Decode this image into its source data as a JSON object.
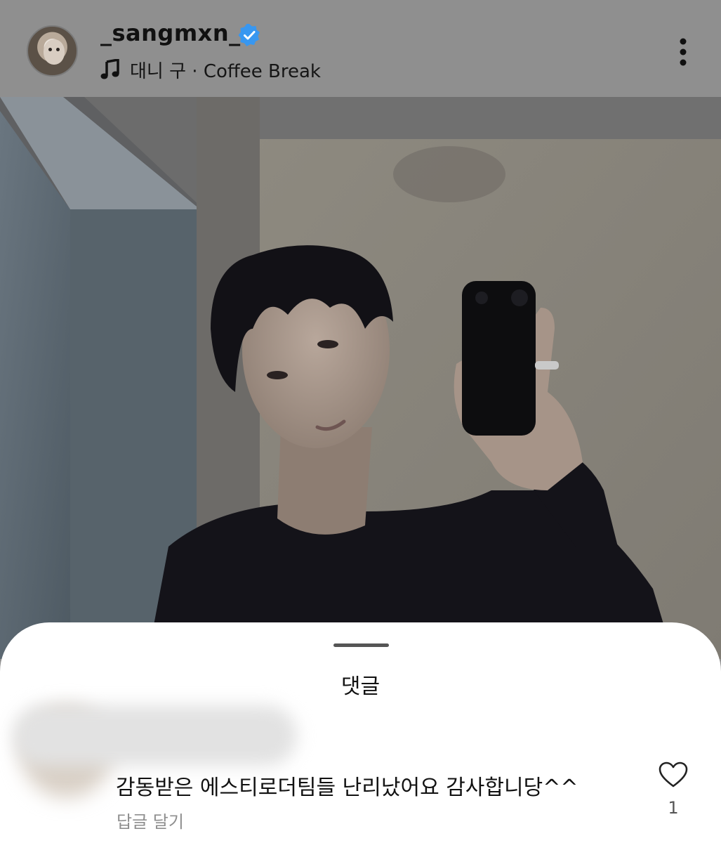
{
  "post": {
    "username": "_sangmxn_",
    "verified": true,
    "music": "대니 구 · Coffee Break",
    "avatar_icon": "dog-avatar",
    "more_icon": "more-vertical-icon"
  },
  "comments_sheet": {
    "title": "댓글",
    "comment": {
      "text": "감동받은 에스티로더팀들 난리났어요 감사합니당^^",
      "reply_label": "답글 달기",
      "like_count": "1",
      "like_icon": "heart-outline-icon"
    }
  },
  "colors": {
    "overlay_gray": "#8f8f8f",
    "verified_blue": "#3897f0",
    "sheet_bg": "#ffffff",
    "secondary_text": "#8e8e8e"
  }
}
